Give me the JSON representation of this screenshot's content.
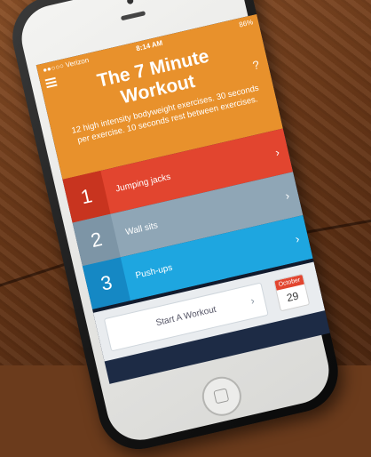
{
  "status": {
    "carrier": "●●○○○ Verizon",
    "time": "8:14 AM",
    "battery": "86%"
  },
  "header": {
    "title_line1": "The 7 Minute",
    "title_line2": "Workout",
    "help": "?",
    "description": "12 high intensity bodyweight exercises. 30 seconds per exercise. 10 seconds rest between exercises."
  },
  "exercises": [
    {
      "number": "1",
      "label": "Jumping jacks",
      "chevron": "›"
    },
    {
      "number": "2",
      "label": "Wall sits",
      "chevron": "›"
    },
    {
      "number": "3",
      "label": "Push-ups",
      "chevron": "›"
    }
  ],
  "footer": {
    "start_label": "Start A Workout",
    "chevron": "›",
    "calendar_month": "October",
    "calendar_day": "29"
  },
  "colors": {
    "hero": "#e8912c",
    "row1": "#e2452f",
    "row2": "#8fa6b6",
    "row3": "#1ea6e0",
    "footer": "#e9ecef"
  },
  "icons": [
    "menu-icon",
    "help-icon",
    "chevron-right-icon",
    "calendar-icon",
    "home-button-icon"
  ]
}
